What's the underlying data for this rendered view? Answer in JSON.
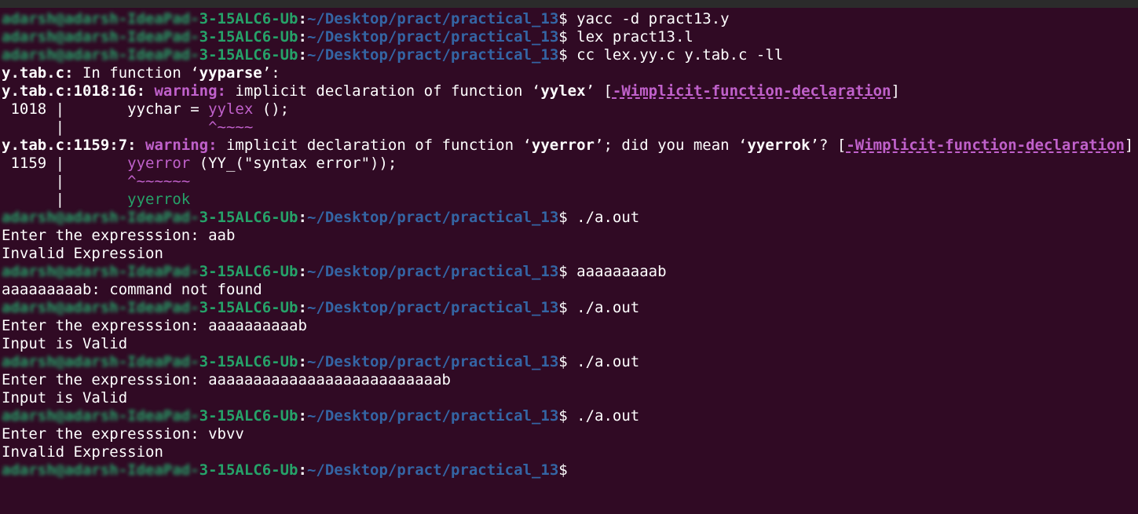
{
  "prompt": {
    "user_obscured": "adarsh@adarsh-IdeaPad-",
    "host_visible": "3-15ALC6-Ub",
    "colon": ":",
    "path": "~/Desktop/pract/practical_13",
    "dollar": "$"
  },
  "lines": {
    "l1_cmd": " yacc -d pract13.y",
    "l2_cmd": " lex pract13.l",
    "l3_cmd": " cc lex.yy.c y.tab.c -ll",
    "l4_file": "y.tab.c:",
    "l4_text": " In function ‘",
    "l4_func": "yyparse",
    "l4_end": "’:",
    "l5_loc": "y.tab.c:1018:16:",
    "l5_warn": " warning:",
    "l5_text": " implicit declaration of function ‘",
    "l5_func": "yylex",
    "l5_mid": "’ [",
    "l5_flag": "-Wimplicit-function-declaration",
    "l5_end": "]",
    "l6_prefix": " 1018 |       yychar = ",
    "l6_hl": "yylex",
    "l6_end": " ();",
    "l7_prefix": "      |                ",
    "l7_caret": "^~~~~",
    "l8_loc": "y.tab.c:1159:7:",
    "l8_warn": " warning:",
    "l8_text": " implicit declaration of function ‘",
    "l8_func": "yyerror",
    "l8_mid": "’; did you mean ‘",
    "l8_func2": "yyerrok",
    "l8_mid2": "’? [",
    "l8_flag": "-Wimplicit-function-declaration",
    "l8_end": "]",
    "l9_prefix": " 1159 |       ",
    "l9_hl": "yyerror",
    "l9_end": " (YY_(\"syntax error\"));",
    "l10_prefix": "      |       ",
    "l10_caret": "^~~~~~~",
    "l11_prefix": "      |       ",
    "l11_fix": "yyerrok",
    "l12_cmd": " ./a.out",
    "l13": "Enter the expresssion: aab",
    "l14": "Invalid Expression",
    "l15_cmd": " aaaaaaaaab",
    "l16": "aaaaaaaaab: command not found",
    "l17_cmd": " ./a.out",
    "l18": "Enter the expresssion: aaaaaaaaaab",
    "l19": "Input is Valid",
    "l20_cmd": " ./a.out",
    "l21": "Enter the expresssion: aaaaaaaaaaaaaaaaaaaaaaaaaab",
    "l22": "Input is Valid",
    "l23_cmd": " ./a.out",
    "l24": "Enter the expresssion: vbvv",
    "l25": "Invalid Expression",
    "l26_cmd": ""
  },
  "colors": {
    "background": "#300a24",
    "prompt_user": "#26a269",
    "prompt_path": "#3465a4",
    "warning": "#c061cb",
    "fixit": "#26a269"
  }
}
